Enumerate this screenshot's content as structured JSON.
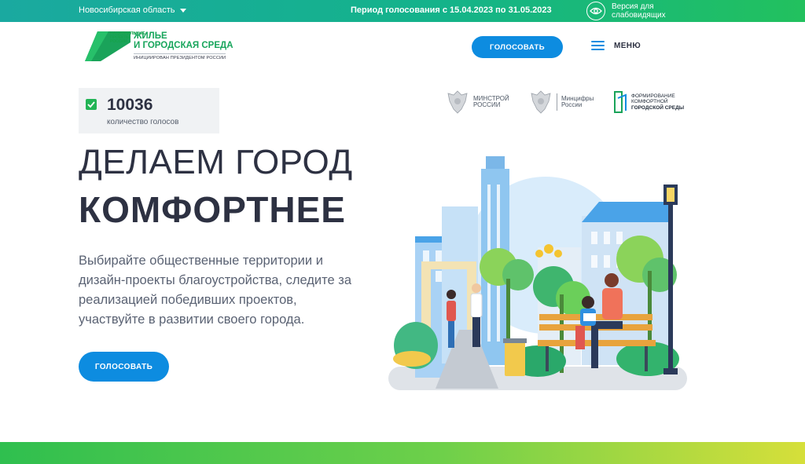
{
  "topbar": {
    "region": "Новосибирская область",
    "period": "Период голосования с 15.04.2023 по 31.05.2023",
    "accessibility": [
      "Версия для",
      "слабовидящих"
    ]
  },
  "logo": {
    "small": "НАЦИОНАЛЬНЫЕ ПРОЕКТЫ РОССИИ",
    "title_line1": "ЖИЛЬЕ",
    "title_line2": "И ГОРОДСКАЯ СРЕДА",
    "subtitle": "ИНИЦИИРОВАН ПРЕЗИДЕНТОМ РОССИИ"
  },
  "header": {
    "vote_label": "ГОЛОСОВАТЬ",
    "menu_label": "МЕНЮ"
  },
  "counter": {
    "value": "10036",
    "label": "количество голосов"
  },
  "partners": [
    {
      "line1": "МИНСТРОЙ",
      "line2": "РОССИИ"
    },
    {
      "line1": "Минцифры",
      "line2": "России"
    },
    {
      "line1": "ФОРМИРОВАНИЕ",
      "line2": "КОМФОРТНОЙ",
      "line3": "ГОРОДСКОЙ СРЕДЫ"
    }
  ],
  "hero": {
    "title_line1": "ДЕЛАЕМ ГОРОД",
    "title_line2": "КОМФОРТНЕЕ",
    "description": [
      "Выбирайте общественные территории и",
      "дизайн-проекты благоустройства, следите за",
      "реализацией победивших проектов,",
      "участвуйте в развитии своего города."
    ],
    "vote_label": "ГОЛОСОВАТЬ"
  },
  "colors": {
    "accent": "#0d8ce0",
    "brand_green": "#17a55b",
    "text": "#2d3142"
  }
}
